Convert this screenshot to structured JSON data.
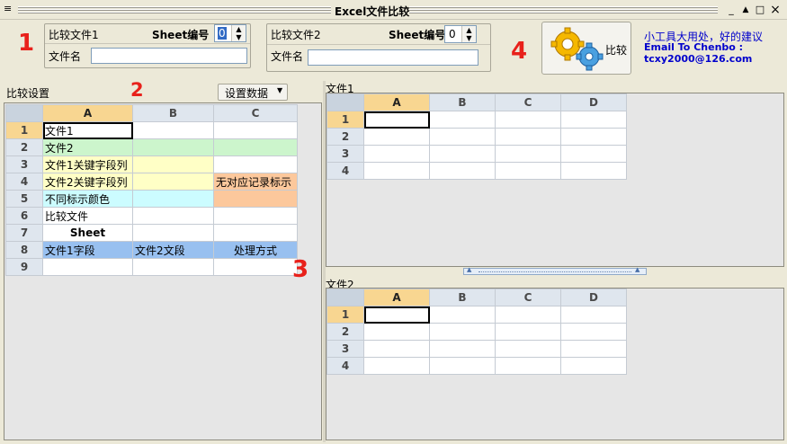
{
  "window": {
    "title": "Excel文件比较",
    "minimize": "_",
    "restore": "▲",
    "maximize": "□",
    "close": "×",
    "system_icon": "≡"
  },
  "markers": {
    "m1": "1",
    "m2": "2",
    "m3": "3",
    "m4": "4"
  },
  "file1": {
    "label": "比较文件1",
    "sheet_label": "Sheet编号",
    "sheet_value": "0",
    "filename_label": "文件名",
    "filename_value": ""
  },
  "file2": {
    "label": "比较文件2",
    "sheet_label": "Sheet编号",
    "sheet_value": "0",
    "filename_label": "文件名",
    "filename_value": ""
  },
  "compare_button": {
    "label": "比较",
    "icon": "gears-icon"
  },
  "info": {
    "line1": "小工具大用处，好的建议",
    "line2": "Email To Chenbo :",
    "line3": "tcxy2000@126.com"
  },
  "settings": {
    "title": "比较设置",
    "dropdown_label": "设置数据"
  },
  "settings_grid": {
    "columns": [
      "A",
      "B",
      "C"
    ],
    "rows": [
      {
        "num": "1",
        "cells": [
          "文件1",
          "",
          ""
        ]
      },
      {
        "num": "2",
        "cells": [
          "文件2",
          "",
          ""
        ]
      },
      {
        "num": "3",
        "cells": [
          "文件1关键字段列",
          "",
          ""
        ]
      },
      {
        "num": "4",
        "cells": [
          "文件2关键字段列",
          "",
          "无对应记录标示"
        ]
      },
      {
        "num": "5",
        "cells": [
          "不同标示颜色",
          "",
          ""
        ]
      },
      {
        "num": "6",
        "cells": [
          "比较文件",
          "",
          ""
        ]
      },
      {
        "num": "7",
        "cells": [
          "Sheet",
          "",
          ""
        ]
      },
      {
        "num": "8",
        "cells": [
          "文件1字段",
          "文件2文段",
          "处理方式"
        ]
      },
      {
        "num": "9",
        "cells": [
          "",
          "",
          ""
        ]
      }
    ]
  },
  "file1_panel": {
    "title": "文件1",
    "columns": [
      "A",
      "B",
      "C",
      "D"
    ],
    "rows": [
      "1",
      "2",
      "3",
      "4"
    ]
  },
  "file2_panel": {
    "title": "文件2",
    "columns": [
      "A",
      "B",
      "C",
      "D"
    ],
    "rows": [
      "1",
      "2",
      "3",
      "4"
    ]
  },
  "colors": {
    "green": "#ccf5cc",
    "yellow": "#ffffc6",
    "cyan": "#ccfcff",
    "orange": "#fcc89c",
    "blue_header": "#98c0f0",
    "accent_red": "#e8211b",
    "link_blue": "#0000cc"
  }
}
